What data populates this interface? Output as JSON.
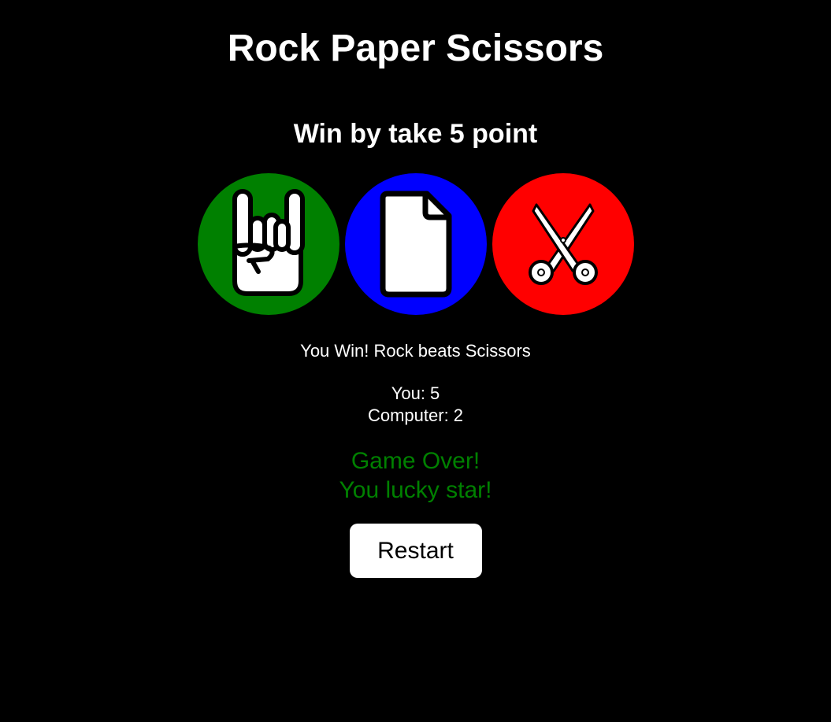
{
  "header": {
    "title": "Rock Paper Scissors"
  },
  "rules": {
    "subtitle": "Win by take 5 point"
  },
  "choices": [
    {
      "name": "Rock",
      "icon": "rock-hand-icon",
      "color": "#008000"
    },
    {
      "name": "Paper",
      "icon": "paper-document-icon",
      "color": "#0000ff"
    },
    {
      "name": "Scissors",
      "icon": "scissors-icon",
      "color": "#ff0000"
    }
  ],
  "result": {
    "message": "You Win! Rock beats Scissors"
  },
  "score": {
    "you_label": "You: 5",
    "computer_label": "Computer: 2"
  },
  "game_over": {
    "line1": "Game Over!",
    "line2": "You lucky star!",
    "color": "#008000"
  },
  "controls": {
    "restart_label": "Restart"
  }
}
